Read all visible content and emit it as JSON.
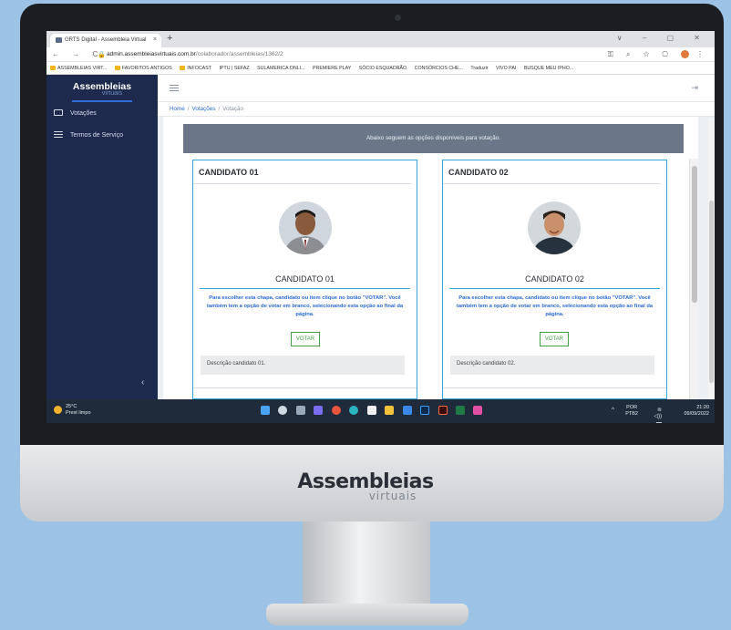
{
  "browser": {
    "tab_title": "GRTS Digital - Assembleia Virtual",
    "tab_close": "×",
    "new_tab": "+",
    "window_controls": "∨  –  ▢  ✕",
    "nav_controls": "← → C",
    "url_host": "admin.assembleiasvirtuais.com.br",
    "url_path": "/colaborador/assembleias/1362/2",
    "bookmarks": [
      "ASSEMBLEIAS VIRT...",
      "FAVORITOS ANTIGOS",
      "INFOCAST",
      "IPTU | SEFAZ",
      "SULAMERICA ONLI...",
      "PREMIERE PLAY",
      "SÓCIO ESQUADRÃO",
      "CONSÓRCIOS CHE...",
      "Traduzir",
      "VIVO PAI",
      "BUSQUE MEU IPHO..."
    ]
  },
  "sidebar": {
    "logo_main": "Assembleias",
    "logo_sub": "virtuais",
    "items": [
      {
        "label": "Votações",
        "icon": "monitor-icon"
      },
      {
        "label": "Termos de Serviço",
        "icon": "list-icon"
      }
    ],
    "collapse": "‹"
  },
  "breadcrumb": {
    "home": "Home",
    "section": "Votações",
    "current": "Votação",
    "sep": "/"
  },
  "banner": "Abaixo seguem as opções disponíveis para votação.",
  "candidates": [
    {
      "title": "CANDIDATO 01",
      "name": "CANDIDATO 01",
      "instructions": "Para escolher esta chapa, candidato ou item clique no botão \"VOTAR\". Você também tem a opção de votar em branco, selecionando esta opção ao final da página.",
      "button": "VOTAR",
      "description": "Descrição candidato 01."
    },
    {
      "title": "CANDIDATO 02",
      "name": "CANDIDATO 02",
      "instructions": "Para escolher esta chapa, candidato ou item clique no botão \"VOTAR\". Você também tem a opção de votar em branco, selecionando esta opção ao final da página.",
      "button": "VOTAR",
      "description": "Descrição candidato 02."
    }
  ],
  "taskbar": {
    "temp": "25°C",
    "weather": "Prest limpo",
    "lang1": "POR",
    "lang2": "PTB2",
    "time": "21:20",
    "date": "09/09/2022"
  },
  "monitor_brand": {
    "main": "Assembleias",
    "sub": "virtuais"
  },
  "colors": {
    "sidebar": "#1d2a4e",
    "accent": "#31a6dd",
    "link": "#2a6bd1",
    "vote": "#43a047",
    "background": "#9cc3e6"
  }
}
